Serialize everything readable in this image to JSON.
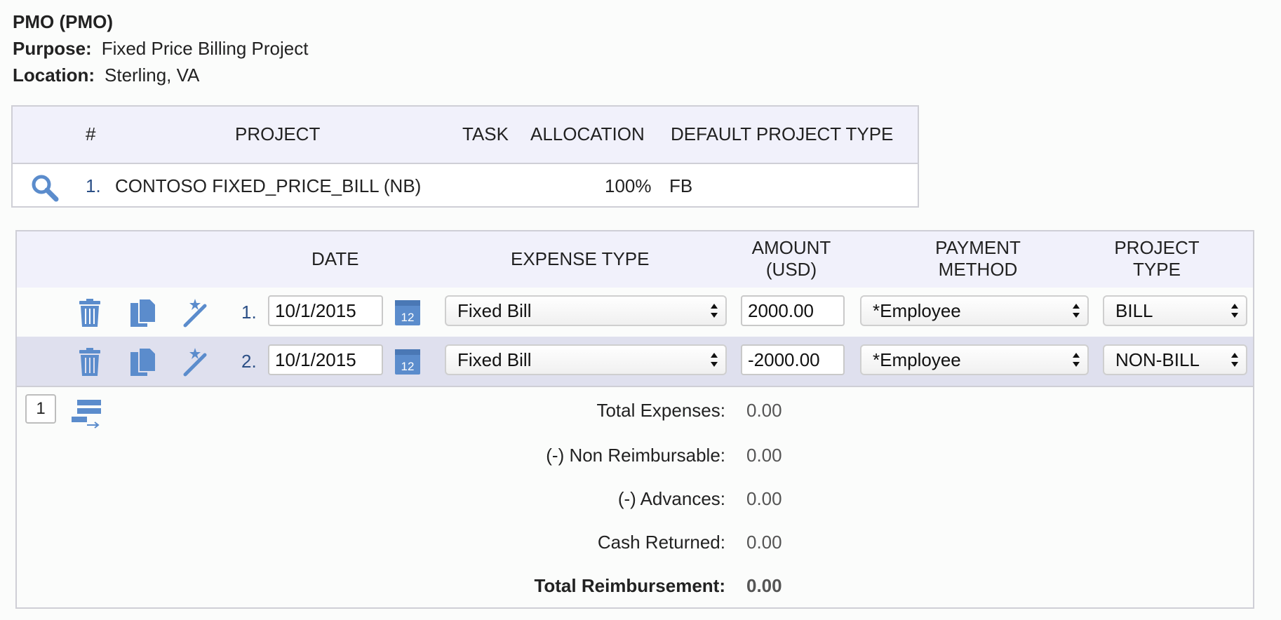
{
  "header": {
    "title": "PMO (PMO)",
    "purpose_label": "Purpose:",
    "purpose_value": "Fixed Price Billing Project",
    "location_label": "Location:",
    "location_value": "Sterling, VA"
  },
  "allocation": {
    "columns": [
      "#",
      "PROJECT",
      "TASK",
      "ALLOCATION",
      "DEFAULT PROJECT TYPE"
    ],
    "rows": [
      {
        "num": "1.",
        "project": "CONTOSO FIXED_PRICE_BILL (NB)",
        "task": "",
        "allocation": "100%",
        "default_type": "FB"
      }
    ]
  },
  "expenses": {
    "columns": {
      "date": "DATE",
      "expense_type": "EXPENSE TYPE",
      "amount_line1": "AMOUNT",
      "amount_line2": "(USD)",
      "payment_line1": "PAYMENT",
      "payment_line2": "METHOD",
      "ptype_line1": "PROJECT",
      "ptype_line2": "TYPE"
    },
    "rows": [
      {
        "num": "1.",
        "date": "10/1/2015",
        "expense_type": "Fixed Bill",
        "amount": "2000.00",
        "payment": "*Employee",
        "project_type": "BILL"
      },
      {
        "num": "2.",
        "date": "10/1/2015",
        "expense_type": "Fixed Bill",
        "amount": "-2000.00",
        "payment": "*Employee",
        "project_type": "NON-BILL"
      }
    ],
    "page_number": "1"
  },
  "summary": {
    "total_expenses_label": "Total Expenses:",
    "total_expenses": "0.00",
    "non_reimbursable_label": "(-) Non Reimbursable:",
    "non_reimbursable": "0.00",
    "advances_label": "(-) Advances:",
    "advances": "0.00",
    "cash_returned_label": "Cash Returned:",
    "cash_returned": "0.00",
    "total_reimbursement_label": "Total Reimbursement:",
    "total_reimbursement": "0.00"
  },
  "colors": {
    "icon_blue": "#5b8ccc",
    "header_bg": "#f1f1fb",
    "alt_row_bg": "#dfe0ee",
    "link_blue": "#2b4f86"
  }
}
